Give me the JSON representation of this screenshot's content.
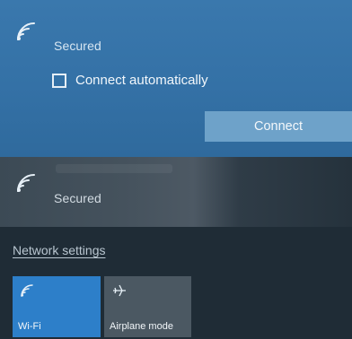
{
  "networks": [
    {
      "icon": "wifi-signal-icon",
      "status": "Secured",
      "connect_automatically_label": "Connect automatically",
      "connect_automatically_checked": false,
      "connect_button_label": "Connect"
    },
    {
      "icon": "wifi-signal-icon",
      "status": "Secured"
    }
  ],
  "footer": {
    "network_settings_link": "Network settings",
    "tiles": [
      {
        "icon": "wifi-icon",
        "label": "Wi-Fi",
        "active": true,
        "color": "#2d7fc9"
      },
      {
        "icon": "airplane-icon",
        "label": "Airplane mode",
        "active": false,
        "color": "#4b5862"
      }
    ]
  },
  "colors": {
    "accent": "#3471a6",
    "button": "#6ea2c9"
  }
}
